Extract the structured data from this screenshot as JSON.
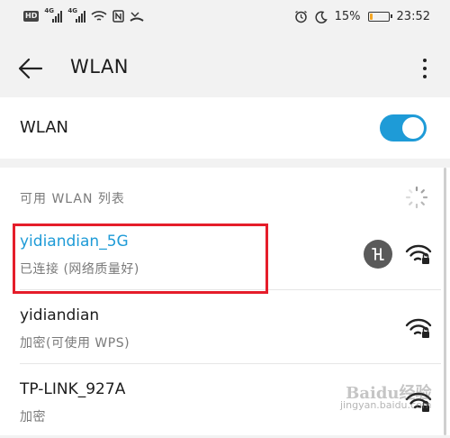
{
  "status_bar": {
    "hd_badge": "HD",
    "net_type_1": "4G",
    "net_type_2": "4G",
    "battery_percent": "15%",
    "battery_level": 0.15,
    "battery_color": "#f5a623",
    "time": "23:52",
    "icons": [
      "signal-icon",
      "signal-icon",
      "wifi-icon",
      "nfc-icon",
      "missed-call-icon",
      "alarm-icon",
      "moon-icon",
      "battery-icon"
    ]
  },
  "toolbar": {
    "title": "WLAN",
    "back_icon": "back-arrow-icon",
    "more_icon": "more-vertical-icon"
  },
  "wlan_switch": {
    "label": "WLAN",
    "on": true,
    "accent": "#1e9bd7"
  },
  "available_list": {
    "header": "可用 WLAN 列表",
    "networks": [
      {
        "name": "yidiandian_5G",
        "status": "已连接 (网络质量好)",
        "connected": true,
        "signal_icon": "wifi-secured-icon",
        "share_icon": "share-hotspot-icon"
      },
      {
        "name": "yidiandian",
        "status": "加密(可使用 WPS)",
        "connected": false,
        "signal_icon": "wifi-secured-icon"
      },
      {
        "name": "TP-LINK_927A",
        "status": "加密",
        "connected": false,
        "signal_icon": "wifi-secured-icon"
      }
    ]
  },
  "highlight_color": "#e51d2a",
  "watermark": {
    "line1": "Baidu经验",
    "line2": "jingyan.baidu.com"
  }
}
